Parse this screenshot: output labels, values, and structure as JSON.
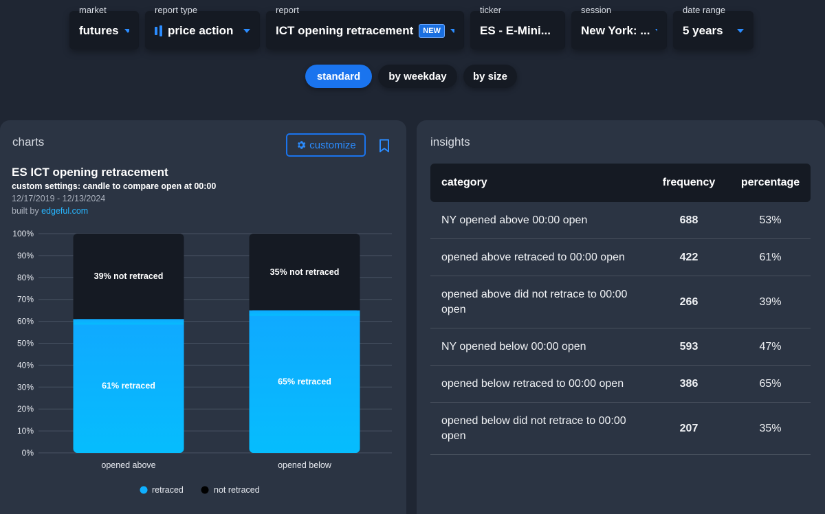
{
  "filters": [
    {
      "label": "market",
      "value": "futures"
    },
    {
      "label": "report type",
      "value": "price action",
      "icon": "candlestick-icon"
    },
    {
      "label": "report",
      "value": "ICT opening retracement",
      "badge": "NEW"
    },
    {
      "label": "ticker",
      "value": "ES - E-Mini..."
    },
    {
      "label": "session",
      "value": "New York: ..."
    },
    {
      "label": "date range",
      "value": "5 years"
    }
  ],
  "tabs": [
    {
      "label": "standard",
      "active": true
    },
    {
      "label": "by weekday",
      "active": false
    },
    {
      "label": "by size",
      "active": false
    }
  ],
  "charts_panel": {
    "title": "charts",
    "customize_label": "customize",
    "chart_title": "ES ICT opening retracement",
    "settings": "custom settings: candle to compare open at 00:00",
    "dates": "12/17/2019 - 12/13/2024",
    "built_by_prefix": "built by ",
    "built_by_link": "edgeful.com"
  },
  "chart_data": {
    "type": "bar",
    "stacked": true,
    "categories": [
      "opened above",
      "opened below"
    ],
    "series": [
      {
        "name": "retraced",
        "values": [
          61,
          65
        ],
        "labels": [
          "61% retraced",
          "65% retraced"
        ],
        "color": "#0fb0ff"
      },
      {
        "name": "not retraced",
        "values": [
          39,
          35
        ],
        "labels": [
          "39% not retraced",
          "35% not retraced"
        ],
        "color": "#151a23"
      }
    ],
    "yticks": [
      "0%",
      "10%",
      "20%",
      "30%",
      "40%",
      "50%",
      "60%",
      "70%",
      "80%",
      "90%",
      "100%"
    ],
    "ylim": [
      0,
      100
    ],
    "grid": true,
    "legend": "bottom"
  },
  "insights": {
    "title": "insights",
    "columns": [
      "category",
      "frequency",
      "percentage"
    ],
    "rows": [
      {
        "category": "NY opened above 00:00 open",
        "frequency": "688",
        "percentage": "53%"
      },
      {
        "category": "opened above retraced to 00:00 open",
        "frequency": "422",
        "percentage": "61%"
      },
      {
        "category": "opened above did not retrace to 00:00 open",
        "frequency": "266",
        "percentage": "39%"
      },
      {
        "category": "NY opened below 00:00 open",
        "frequency": "593",
        "percentage": "47%"
      },
      {
        "category": "opened below retraced to 00:00 open",
        "frequency": "386",
        "percentage": "65%"
      },
      {
        "category": "opened below did not retrace to 00:00 open",
        "frequency": "207",
        "percentage": "35%"
      }
    ]
  }
}
